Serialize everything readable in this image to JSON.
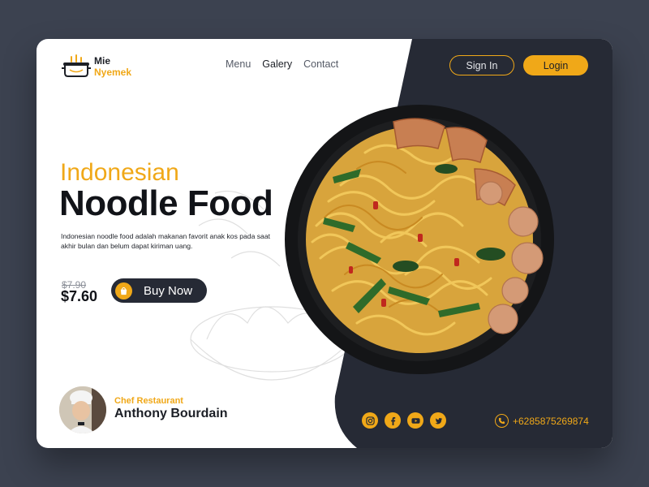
{
  "brand": {
    "name_line1": "Mie",
    "name_line2": "Nyemek"
  },
  "nav": {
    "items": [
      "Menu",
      "Galery",
      "Contact"
    ],
    "active": "Galery"
  },
  "auth": {
    "signin_label": "Sign In",
    "login_label": "Login"
  },
  "hero": {
    "subtitle": "Indonesian",
    "title": "Noodle Food",
    "description": "Indonesian noodle food adalah makanan favorit anak kos pada saat akhir bulan dan belum dapat kiriman uang."
  },
  "pricing": {
    "old_price": "$7.90",
    "price": "$7.60",
    "buy_label": "Buy Now"
  },
  "chef": {
    "role": "Chef Restaurant",
    "name": "Anthony Bourdain"
  },
  "socials": [
    "instagram-icon",
    "facebook-icon",
    "youtube-icon",
    "twitter-icon"
  ],
  "contact": {
    "phone": "+6285875269874"
  },
  "colors": {
    "accent": "#f0a818",
    "dark": "#262a35",
    "background": "#3c4250",
    "card": "#ffffff"
  }
}
